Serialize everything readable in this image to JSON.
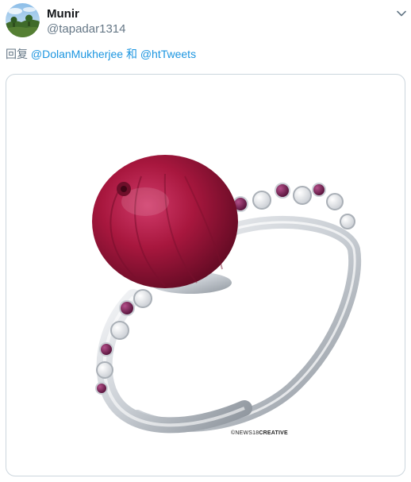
{
  "tweet": {
    "display_name": "Munir",
    "handle": "@tapadar1314",
    "menu_icon": "chevron-down-icon",
    "avatar_icon": "landscape-avatar"
  },
  "reply": {
    "prefix": "回复",
    "mention_1": "@DolanMukherjee",
    "separator": "和",
    "mention_2": "@htTweets"
  },
  "media": {
    "credit_prefix": "©NEWS18",
    "credit_suffix": "CREATIVE",
    "colors": {
      "onion": "#a8173e",
      "metal": "#d9dde2",
      "amethyst": "#6b1a4a",
      "link": "#1b95e0"
    }
  }
}
